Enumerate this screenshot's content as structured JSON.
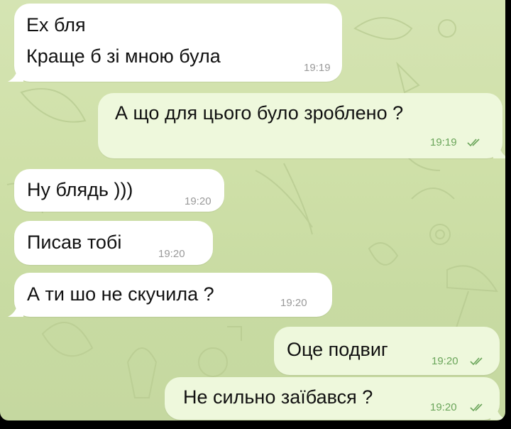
{
  "messages": [
    {
      "direction": "incoming",
      "lines": [
        "Ех бля",
        "Краще б зі мною була"
      ],
      "time": "19:19"
    },
    {
      "direction": "outgoing",
      "lines": [
        "А що для цього було зроблено ?"
      ],
      "time": "19:19",
      "status_icon": "double-check-icon"
    },
    {
      "direction": "incoming",
      "lines": [
        "Ну блядь )))"
      ],
      "time": "19:20"
    },
    {
      "direction": "incoming",
      "lines": [
        "Писав тобі"
      ],
      "time": "19:20"
    },
    {
      "direction": "incoming",
      "lines": [
        "А ти шо не скучила ?"
      ],
      "time": "19:20"
    },
    {
      "direction": "outgoing",
      "lines": [
        "Оце подвиг"
      ],
      "time": "19:20",
      "status_icon": "double-check-icon"
    },
    {
      "direction": "outgoing",
      "lines": [
        "Не сильно заїбався ?"
      ],
      "time": "19:20",
      "status_icon": "double-check-icon"
    }
  ],
  "colors": {
    "incoming_bubble": "#ffffff",
    "outgoing_bubble": "#eef8dc",
    "outgoing_time": "#6aa55a",
    "incoming_time": "#9a9a9a",
    "wallpaper": "#cfe0a8"
  }
}
